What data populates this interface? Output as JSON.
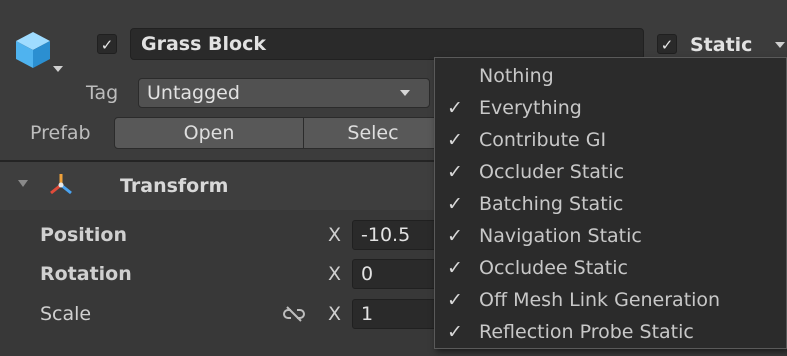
{
  "object": {
    "name": "Grass Block",
    "active_check": "✓",
    "static_check": "✓",
    "static_label": "Static",
    "tag_label": "Tag",
    "tag_value": "Untagged",
    "prefab_label": "Prefab",
    "prefab_open": "Open",
    "prefab_select": "Selec"
  },
  "transform": {
    "title": "Transform",
    "rows": [
      {
        "label": "Position",
        "axis": "X",
        "value": "-10.5"
      },
      {
        "label": "Rotation",
        "axis": "X",
        "value": "0"
      },
      {
        "label": "Scale",
        "axis": "X",
        "value": "1"
      }
    ]
  },
  "static_menu": {
    "items": [
      {
        "label": "Nothing",
        "check": ""
      },
      {
        "label": "Everything",
        "check": "✓"
      },
      {
        "label": "Contribute GI",
        "check": "✓"
      },
      {
        "label": "Occluder Static",
        "check": "✓"
      },
      {
        "label": "Batching Static",
        "check": "✓"
      },
      {
        "label": "Navigation Static",
        "check": "✓"
      },
      {
        "label": "Occludee Static",
        "check": "✓"
      },
      {
        "label": "Off Mesh Link Generation",
        "check": "✓"
      },
      {
        "label": "Reflection Probe Static",
        "check": "✓"
      }
    ]
  },
  "colors": {
    "background": "#383838",
    "field": "#2a2a2a",
    "popup": "#2b2b2b",
    "cube_icon": "#4fb3ef"
  },
  "icons": [
    "gameobject-cube-icon",
    "transform-axes-icon",
    "unlinked-chain-icon",
    "checkmark-icon"
  ]
}
